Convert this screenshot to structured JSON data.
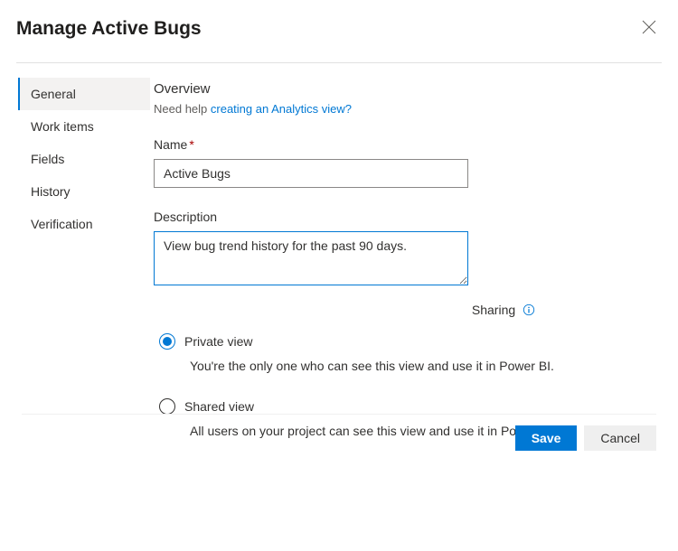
{
  "dialog": {
    "title": "Manage Active Bugs"
  },
  "sidebar": {
    "items": [
      {
        "label": "General",
        "active": true
      },
      {
        "label": "Work items",
        "active": false
      },
      {
        "label": "Fields",
        "active": false
      },
      {
        "label": "History",
        "active": false
      },
      {
        "label": "Verification",
        "active": false
      }
    ]
  },
  "overview": {
    "heading": "Overview",
    "help_prefix": "Need help ",
    "help_link": "creating an Analytics view?"
  },
  "fields": {
    "name_label": "Name",
    "name_value": "Active Bugs",
    "desc_label": "Description",
    "desc_value": "View bug trend history for the past 90 days."
  },
  "sharing": {
    "label": "Sharing",
    "options": [
      {
        "label": "Private view",
        "desc": "You're the only one who can see this view and use it in Power BI.",
        "checked": true
      },
      {
        "label": "Shared view",
        "desc": "All users on your project can see this view and use it in Power BI.",
        "checked": false
      }
    ]
  },
  "buttons": {
    "save": "Save",
    "cancel": "Cancel"
  }
}
